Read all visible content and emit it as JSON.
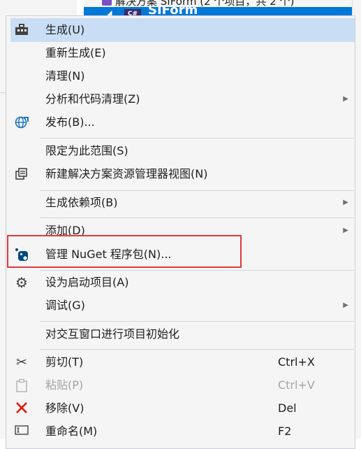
{
  "background": {
    "tree_row_top": "解决方案 SIForm (2 个项目，共 2 个)",
    "tree_row_selected": "SIForm",
    "cs_badge": "C#"
  },
  "menu": {
    "items": [
      {
        "label": "生成(U)",
        "icon": "build-icon",
        "highlighted": true
      },
      {
        "label": "重新生成(E)"
      },
      {
        "label": "清理(N)"
      },
      {
        "label": "分析和代码清理(Z)",
        "submenu": true
      },
      {
        "label": "发布(B)...",
        "icon": "publish-globe-icon"
      },
      {
        "label": "限定为此范围(S)"
      },
      {
        "label": "新建解决方案资源管理器视图(N)",
        "icon": "new-view-icon"
      },
      {
        "label": "生成依赖项(B)",
        "submenu": true
      },
      {
        "label": "添加(D)",
        "submenu": true
      },
      {
        "label": "管理 NuGet 程序包(N)...",
        "icon": "nuget-icon"
      },
      {
        "label": "设为启动项目(A)",
        "icon": "gear-icon"
      },
      {
        "label": "调试(G)",
        "submenu": true
      },
      {
        "label": "对交互窗口进行项目初始化"
      },
      {
        "label": "剪切(T)",
        "icon": "scissors-icon",
        "shortcut": "Ctrl+X"
      },
      {
        "label": "粘贴(P)",
        "icon": "clipboard-icon",
        "shortcut": "Ctrl+V",
        "disabled": true
      },
      {
        "label": "移除(V)",
        "icon": "remove-x-icon",
        "shortcut": "Del"
      },
      {
        "label": "重命名(M)",
        "icon": "rename-icon",
        "shortcut": "F2"
      }
    ],
    "submenu_glyph": "▶"
  },
  "colors": {
    "menu_bg": "#f5f5f5",
    "highlight": "#c9def5",
    "annotation_box": "#e03a3a",
    "accent_blue": "#0078d7",
    "remove_red": "#e51400"
  }
}
